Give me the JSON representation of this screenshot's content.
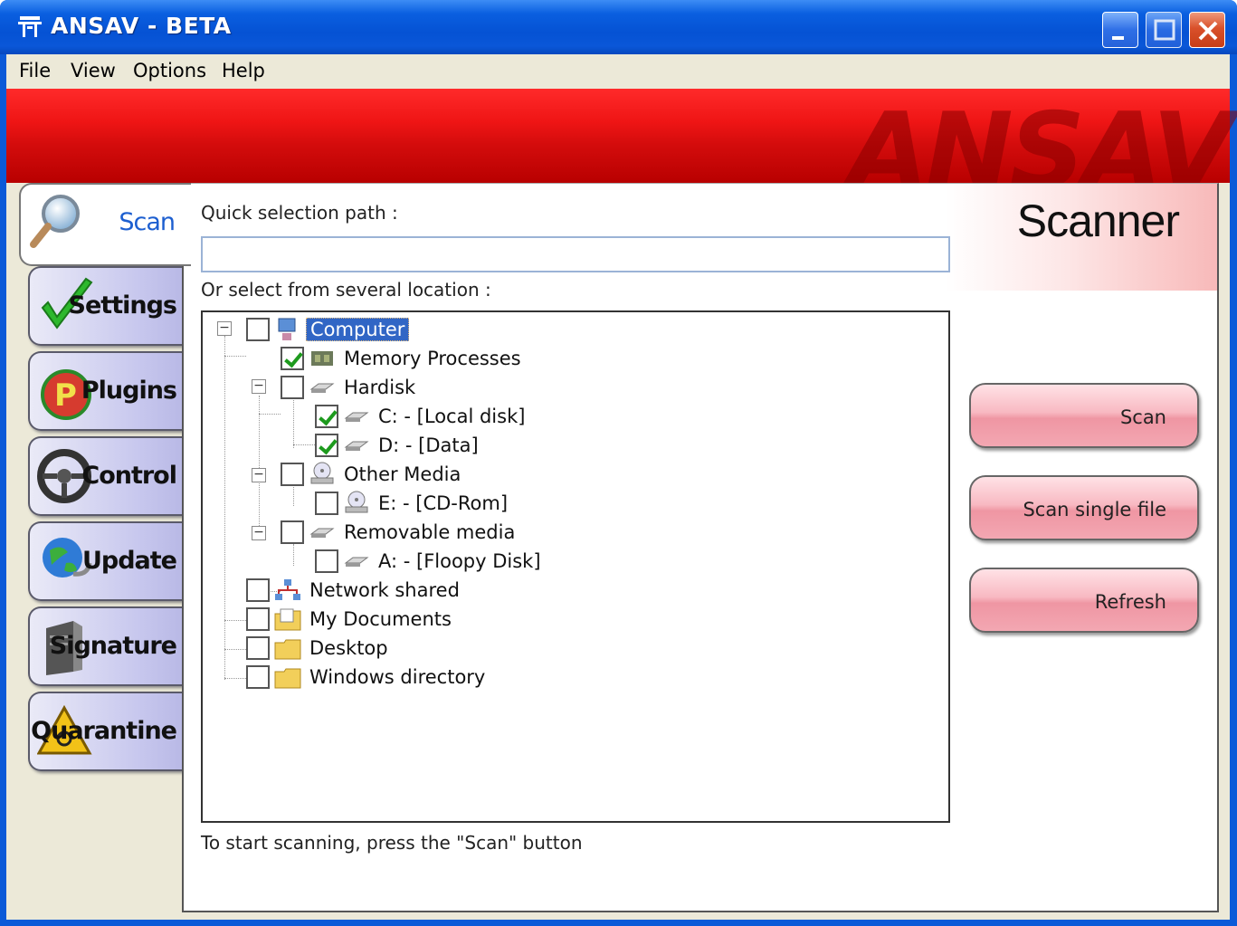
{
  "window": {
    "title": "ANSAV - BETA",
    "controls": [
      "minimize-icon",
      "maximize-icon",
      "close-icon"
    ]
  },
  "menu": [
    "File",
    "View",
    "Options",
    "Help"
  ],
  "banner": {
    "brand": "ANSAV"
  },
  "tabs": [
    {
      "label": "Scan",
      "icon": "magnifier-icon",
      "active": true
    },
    {
      "label": "Settings",
      "icon": "checkmark-icon"
    },
    {
      "label": "Plugins",
      "icon": "plugins-icon"
    },
    {
      "label": "Control",
      "icon": "steering-wheel-icon"
    },
    {
      "label": "Update",
      "icon": "globe-update-icon"
    },
    {
      "label": "Signature",
      "icon": "server-icon"
    },
    {
      "label": "Quarantine",
      "icon": "biohazard-icon"
    }
  ],
  "scanner": {
    "heading": "Scanner",
    "quick_path_label": "Quick selection path :",
    "quick_path_value": "",
    "locations_label": "Or select from several location :",
    "status": "To start scanning, press the \"Scan\" button",
    "tree": [
      {
        "label": "Computer",
        "checked": false,
        "icon": "computer-icon",
        "selected": true
      },
      {
        "label": "Memory Processes",
        "checked": true,
        "icon": "memory-chip-icon"
      },
      {
        "label": "Hardisk",
        "checked": false,
        "icon": "drive-icon"
      },
      {
        "label": "C: - [Local disk]",
        "checked": true,
        "icon": "drive-icon"
      },
      {
        "label": "D: - [Data]",
        "checked": true,
        "icon": "drive-icon"
      },
      {
        "label": "Other Media",
        "checked": false,
        "icon": "cd-drive-icon"
      },
      {
        "label": "E: - [CD-Rom]",
        "checked": false,
        "icon": "cd-drive-icon"
      },
      {
        "label": "Removable media",
        "checked": false,
        "icon": "drive-icon"
      },
      {
        "label": "A: - [Floopy Disk]",
        "checked": false,
        "icon": "drive-icon"
      },
      {
        "label": "Network shared",
        "checked": false,
        "icon": "network-icon"
      },
      {
        "label": "My Documents",
        "checked": false,
        "icon": "documents-folder-icon"
      },
      {
        "label": "Desktop",
        "checked": false,
        "icon": "folder-icon"
      },
      {
        "label": "Windows directory",
        "checked": false,
        "icon": "folder-icon"
      }
    ],
    "buttons": [
      "Scan",
      "Scan single file",
      "Refresh"
    ]
  }
}
